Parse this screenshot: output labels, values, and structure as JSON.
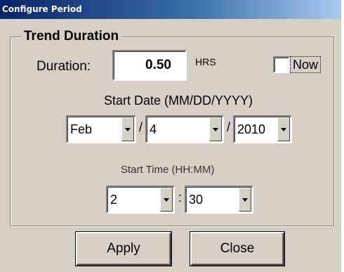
{
  "window": {
    "title": "Configure Period"
  },
  "group": {
    "title": "Trend Duration"
  },
  "duration": {
    "label": "Duration:",
    "value": "0.50",
    "unit": "HRS"
  },
  "now": {
    "label": "Now",
    "checked": false
  },
  "start_date": {
    "label": "Start Date (MM/DD/YYYY)",
    "month": "Feb",
    "day": "4",
    "year": "2010",
    "separator": "/"
  },
  "start_time": {
    "label": "Start Time (HH:MM)",
    "hour": "2",
    "minute": "30",
    "separator": ":"
  },
  "buttons": {
    "apply": "Apply",
    "close": "Close"
  },
  "icons": {
    "combo_arrow": "triangle-down-icon"
  },
  "colors": {
    "face": "#d4d0c8",
    "title_start": "#0a246a",
    "title_end": "#a6caf0"
  }
}
